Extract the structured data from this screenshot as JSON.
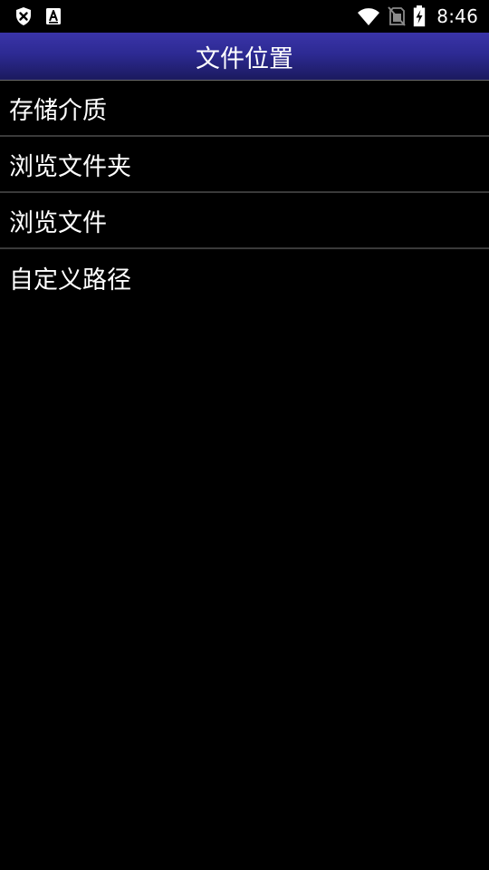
{
  "status_bar": {
    "time": "8:46",
    "icons": {
      "left": [
        "shield-x-icon",
        "font-a-icon"
      ],
      "right": [
        "wifi-icon",
        "no-sim-icon",
        "battery-charging-icon"
      ]
    }
  },
  "header": {
    "title": "文件位置"
  },
  "menu": {
    "items": [
      {
        "label": "存储介质"
      },
      {
        "label": "浏览文件夹"
      },
      {
        "label": "浏览文件"
      },
      {
        "label": "自定义路径"
      }
    ]
  },
  "colors": {
    "background": "#000000",
    "title_gradient_top": "#3a34a8",
    "title_gradient_bottom": "#1b1a5e",
    "divider": "#3a3a3a",
    "text": "#ffffff"
  }
}
